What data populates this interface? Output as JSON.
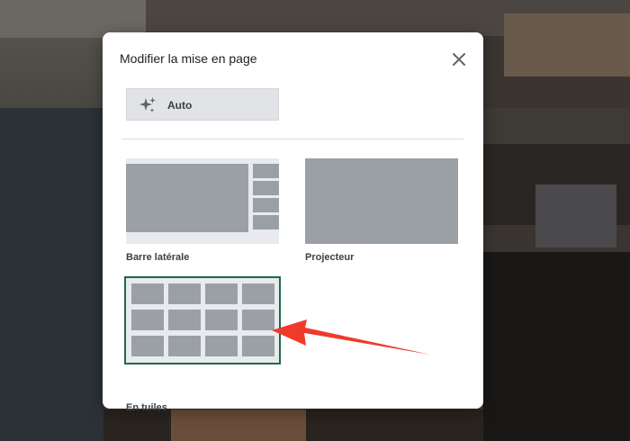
{
  "dialog": {
    "title": "Modifier la mise en page",
    "auto_label": "Auto",
    "options": [
      {
        "label": "Barre latérale",
        "selected": false
      },
      {
        "label": "Projecteur",
        "selected": false
      },
      {
        "label": "En tuiles",
        "selected": true
      }
    ]
  },
  "icons": {
    "close": "close-icon",
    "auto": "sparkle-icon"
  },
  "colors": {
    "selected_border": "#1e6a4a",
    "thumbnail_tile": "#9aa0a6",
    "annotation_arrow": "#f03a2a"
  }
}
